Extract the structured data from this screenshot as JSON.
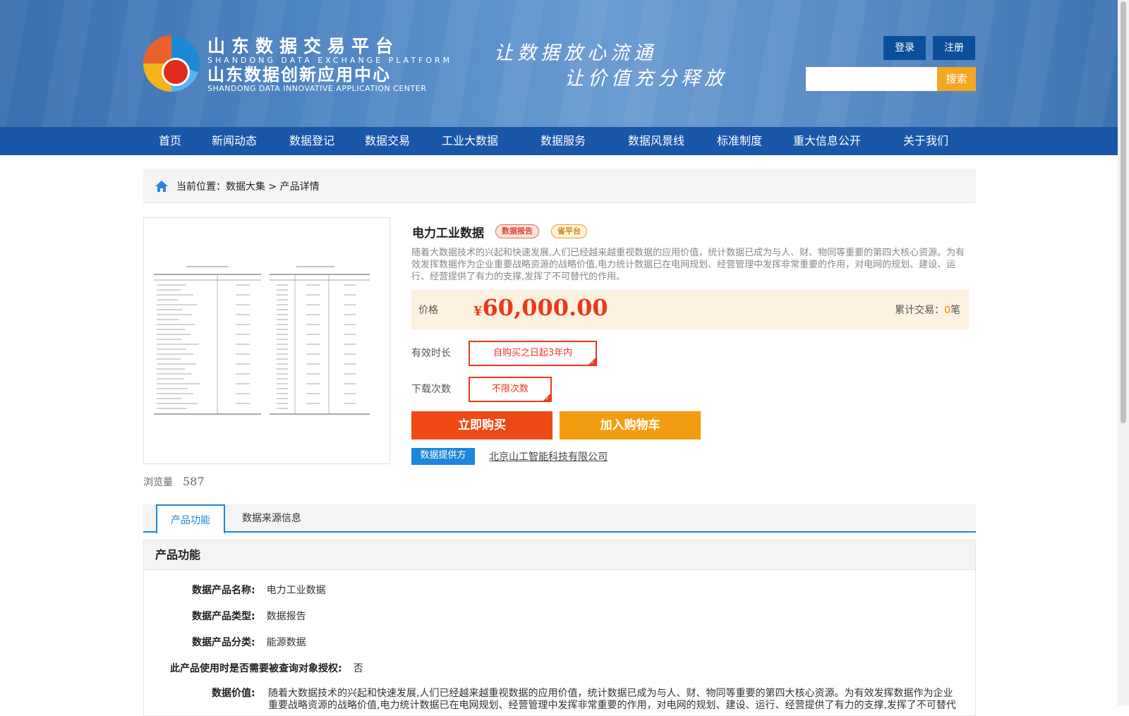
{
  "header": {
    "logo_cn_1": "山东数据交易平台",
    "logo_en_1": "SHANDONG DATA EXCHANGE PLATFORM",
    "logo_cn_2": "山东数据创新应用中心",
    "logo_en_2": "SHANDONG DATA INNOVATIVE APPLICATION CENTER",
    "slogan_1": "让数据放心流通",
    "slogan_2": "让价值充分释放",
    "login_label": "登录",
    "register_label": "注册",
    "search_placeholder": "",
    "search_label": "搜索"
  },
  "nav": {
    "items": [
      "首页",
      "新闻动态",
      "数据登记",
      "数据交易",
      "工业大数据",
      "数据服务",
      "数据风景线",
      "标准制度",
      "重大信息公开",
      "关于我们"
    ]
  },
  "breadcrumb": {
    "text": "当前位置：数据大集 > 产品详情"
  },
  "product": {
    "views_label": "浏览量",
    "views": "587",
    "title": "电力工业数据",
    "tag_report": "数据报告",
    "tag_province": "省平台",
    "description": "随着大数据技术的兴起和快速发展,人们已经越来越重视数据的应用价值，统计数据已成为与人、财、物同等重要的第四大核心资源。为有效发挥数据作为企业重要战略资源的战略价值,电力统计数据已在电网规划、经营管理中发挥非常重要的作用，对电网的规划、建设、运行、经营提供了有力的支撑,发挥了不可替代的作用。",
    "price_label": "价格",
    "currency": "¥",
    "price": "60,000.00",
    "deals_label": "累计交易：",
    "deals_count": "0",
    "deals_unit": "笔",
    "duration_label": "有效时长",
    "duration_value": "自购买之日起3年内",
    "download_label": "下载次数",
    "download_value": "不限次数",
    "buy_label": "立即购买",
    "cart_label": "加入购物车",
    "provider_label": "数据提供方",
    "provider_name": "北京山工智能科技有限公司"
  },
  "tabs": [
    "产品功能",
    "数据来源信息"
  ],
  "details": {
    "section_title": "产品功能",
    "name_label": "数据产品名称:",
    "name_value": "电力工业数据",
    "type_label": "数据产品类型:",
    "type_value": "数据报告",
    "category_label": "数据产品分类:",
    "category_value": "能源数据",
    "auth_label": "此产品使用时是否需要被查询对象授权:",
    "auth_value": "否",
    "value_label": "数据价值:",
    "value_text": "随着大数据技术的兴起和快速发展,人们已经越来越重视数据的应用价值，统计数据已成为与人、财、物同等重要的第四大核心资源。为有效发挥数据作为企业重要战略资源的战略价值,电力统计数据已在电网规划、经营管理中发挥非常重要的作用，对电网的规划、建设、运行、经营提供了有力的支撑,发挥了不可替代"
  },
  "colors": {
    "nav_blue": "#1a56a8",
    "accent_red": "#e8391f",
    "accent_orange": "#f39c12",
    "link_blue": "#1c87d8"
  }
}
